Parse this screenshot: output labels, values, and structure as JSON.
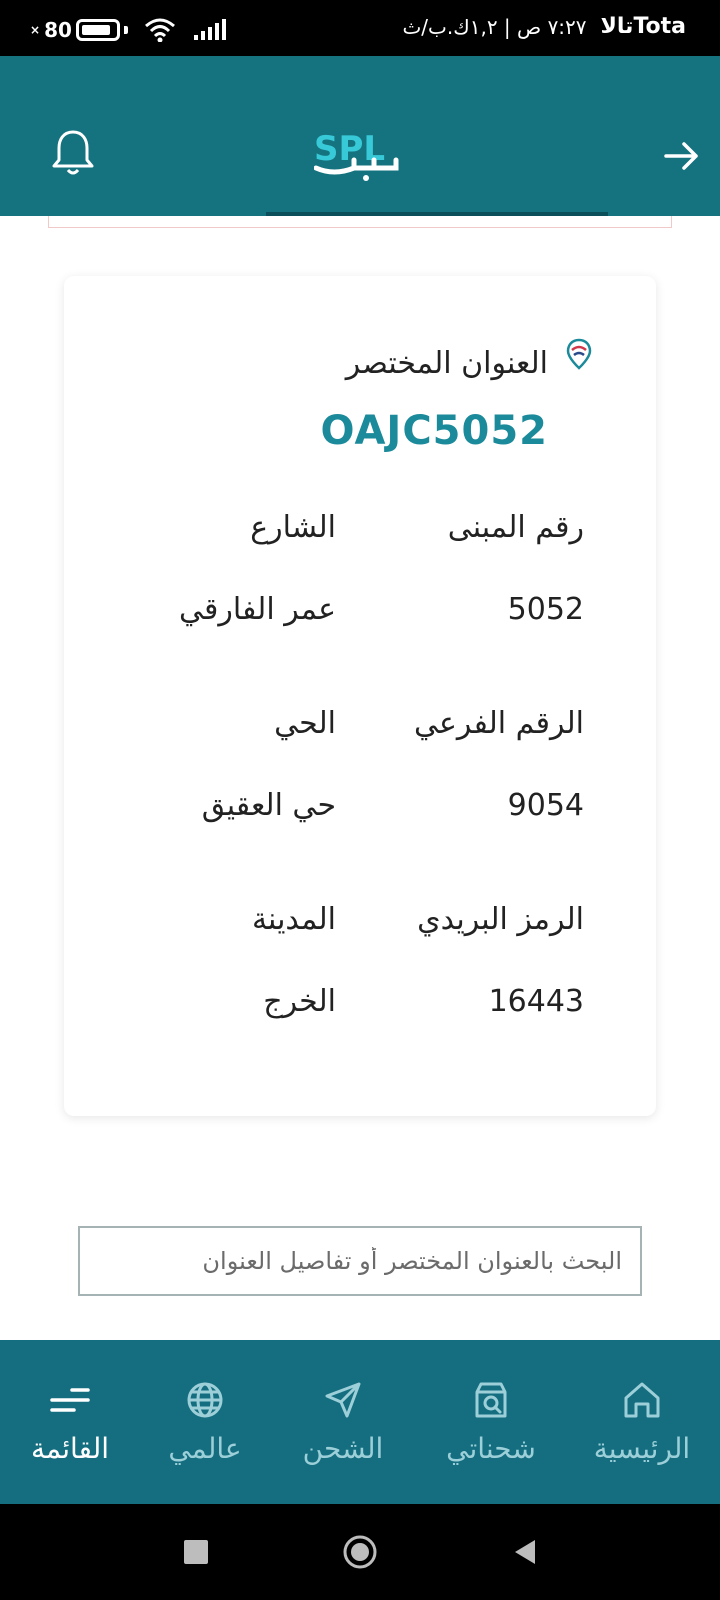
{
  "status_bar": {
    "carrier": "Totaتالا",
    "time_info": "٧:٢٧ ص | ١,٢ك.ب/ث",
    "battery": "80"
  },
  "header": {
    "logo_text": "SPL",
    "brand_color": "#15737f"
  },
  "card": {
    "short_address_label": "العنوان المختصر",
    "short_address_code": "OAJC5052",
    "fields": [
      {
        "label": "رقم المبنى",
        "value": "5052"
      },
      {
        "label": "الشارع",
        "value": "عمر الفارقي"
      },
      {
        "label": "الرقم الفرعي",
        "value": "9054"
      },
      {
        "label": "الحي",
        "value": "حي العقيق"
      },
      {
        "label": "الرمز البريدي",
        "value": "16443"
      },
      {
        "label": "المدينة",
        "value": "الخرج"
      }
    ]
  },
  "search": {
    "placeholder": "البحث بالعنوان المختصر أو تفاصيل العنوان",
    "value": ""
  },
  "bottom_nav": {
    "items": [
      {
        "label": "الرئيسية",
        "icon": "home-icon"
      },
      {
        "label": "شحناتي",
        "icon": "shipment-search-icon"
      },
      {
        "label": "الشحن",
        "icon": "send-icon"
      },
      {
        "label": "عالمي",
        "icon": "globe-icon"
      },
      {
        "label": "القائمة",
        "icon": "menu-icon",
        "active": true
      }
    ]
  }
}
